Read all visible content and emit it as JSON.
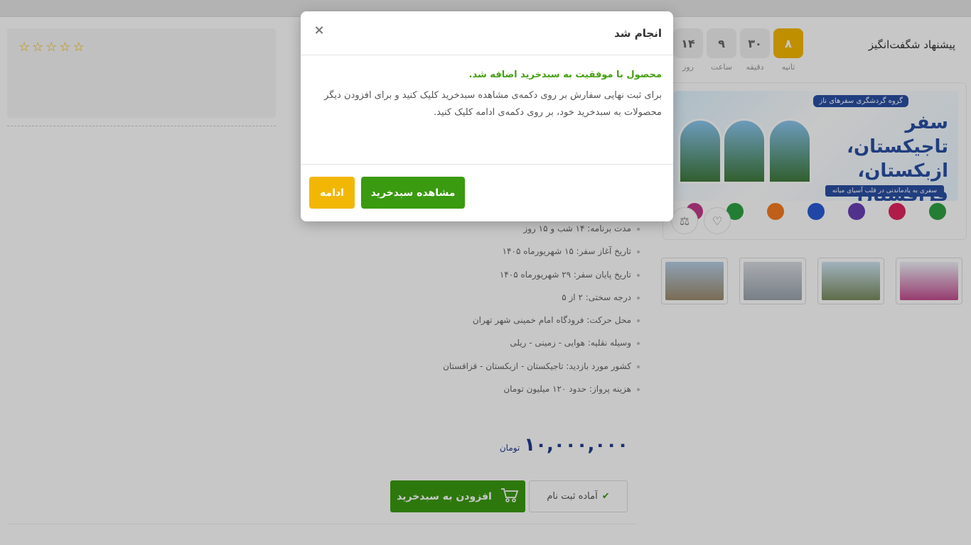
{
  "offer": {
    "title": "پیشنهاد شگفت‌انگیز",
    "timer": [
      {
        "value": "۸",
        "label": "ثانیه"
      },
      {
        "value": "۳۰",
        "label": "دقیقه"
      },
      {
        "value": "۹",
        "label": "ساعت"
      },
      {
        "value": "۱۴",
        "label": "روز"
      }
    ]
  },
  "rating": {
    "stars": [
      "☆",
      "☆",
      "☆",
      "☆",
      "☆"
    ]
  },
  "banner": {
    "badge": "گروه گردشگری سفرهای ناز",
    "title": "سفر تاجیکستان، ازبکستان، قزاقستان",
    "subtitle": "سفری به یادماندنی در قلب آسیای میانه",
    "feature_colors": [
      "#2ea043",
      "#e0245e",
      "#6a3fb5",
      "#2a5bd7",
      "#f47c20",
      "#2ea043",
      "#c13b8a"
    ]
  },
  "specs": [
    "مدت برنامه: ۱۴ شب و ۱۵ روز",
    "تاریخ آغاز سفر: ۱۵ شهریورماه ۱۴۰۵",
    "تاریخ پایان سفر: ۲۹ شهریورماه ۱۴۰۵",
    "درجه سختی: ۲ از ۵",
    "محل حرکت: فرودگاه امام خمینی شهر تهران",
    "وسیله نقلیه: هوایی - زمینی - ریلی",
    "کشور مورد بازدید: تاجیکستان - ازبکستان - قزاقستان",
    "هزینه پرواز: حدود ۱۲۰ میلیون تومان"
  ],
  "price": {
    "amount": "۱۰,۰۰۰,۰۰۰",
    "currency": "تومان"
  },
  "buttons": {
    "add_to_cart": "افزودن به سبدخرید",
    "ready": "آماده ثبت نام"
  },
  "modal": {
    "title": "انجام شد",
    "close": "×",
    "success": "محصول با موفقیت به سبدخرید اضافه شد.",
    "info": "برای ثبت نهایی سفارش بر روی دکمه‌ی مشاهده سبدخرید کلیک کنید و برای افزودن دیگر محصولات به سبدخرید خود، بر روی دکمه‌ی ادامه کلیک کنید.",
    "view_cart": "مشاهده سبدخرید",
    "continue": "ادامه"
  }
}
